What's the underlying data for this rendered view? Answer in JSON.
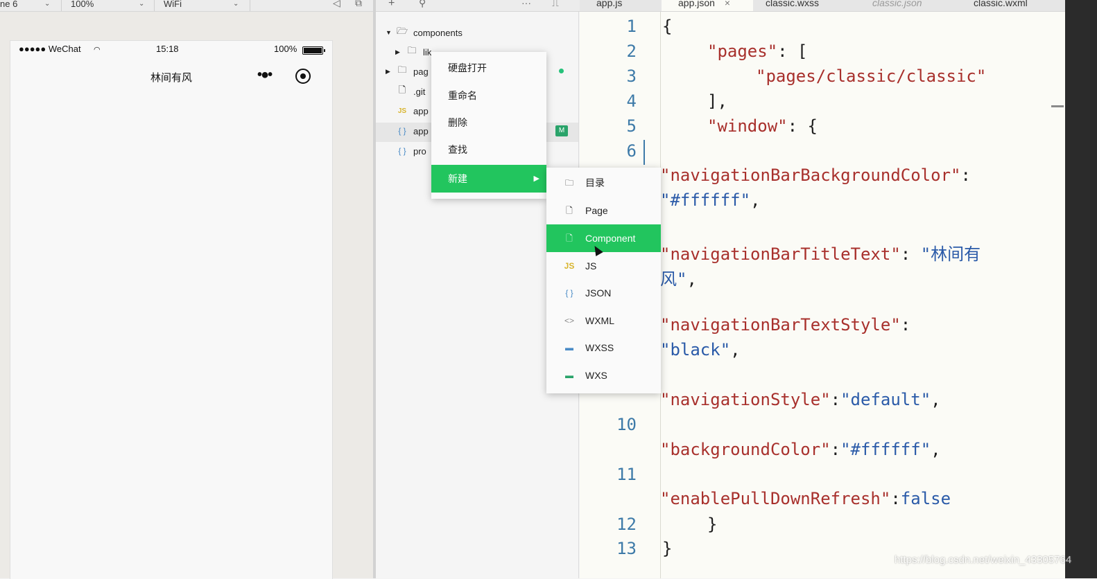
{
  "toolbar": {
    "device": "ne 6",
    "zoom": "100%",
    "network": "WiFi",
    "add_icon": "+",
    "search_icon": "⚲",
    "more_icon": "···"
  },
  "tabs": [
    {
      "label": "app.js"
    },
    {
      "label": "app.json",
      "close": "×"
    },
    {
      "label": "classic.wxss"
    },
    {
      "label": "classic.json"
    },
    {
      "label": "classic.wxml"
    }
  ],
  "phone": {
    "carrier": "●●●●● WeChat",
    "time": "15:18",
    "battery_text": "100%",
    "nav_title": "林间有风",
    "capsule_dots": "•●•"
  },
  "explorer": {
    "items": [
      {
        "label": "components"
      },
      {
        "label": "lik"
      },
      {
        "label": "pag"
      },
      {
        "label": ".git"
      },
      {
        "label": "app"
      },
      {
        "label": "app"
      },
      {
        "label": "pro"
      }
    ],
    "modified_badge": "M"
  },
  "context_menu": {
    "items": [
      "硬盘打开",
      "重命名",
      "删除",
      "查找",
      "新建"
    ],
    "submenu_arrow": "▶"
  },
  "submenu": {
    "items": [
      {
        "label": "目录",
        "icon": "folder-icon"
      },
      {
        "label": "Page",
        "icon": "file-icon"
      },
      {
        "label": "Component",
        "icon": "file-icon"
      },
      {
        "label": "JS",
        "icon": "js-icon"
      },
      {
        "label": "JSON",
        "icon": "json-icon"
      },
      {
        "label": "WXML",
        "icon": "wxml-icon"
      },
      {
        "label": "WXSS",
        "icon": "wxss-icon"
      },
      {
        "label": "WXS",
        "icon": "wxs-icon"
      }
    ]
  },
  "editor": {
    "line_numbers": [
      "1",
      "2",
      "3",
      "4",
      "5",
      "6",
      "10",
      "11",
      "12",
      "13"
    ],
    "lines": {
      "l1": "{",
      "l2_key": "\"pages\"",
      "l2_rest": ": [",
      "l3": "\"pages/classic/classic\"",
      "l4": "],",
      "l5_key": "\"window\"",
      "l5_rest": ": {",
      "l7_key": "\"navigationBarBackgroundColor\"",
      "l7_rest": ":",
      "l8_val": "\"#ffffff\"",
      "l8_rest": ",",
      "l9_key": "\"navigationBarTitleText\"",
      "l9_sep": ": ",
      "l9_val": "\"林间有",
      "l10_val": "风\"",
      "l10_rest": ",",
      "l11_key": "\"navigationBarTextStyle\"",
      "l11_rest": ":",
      "l12_val": "\"black\"",
      "l12_rest": ",",
      "l13_key": "\"navigationStyle\"",
      "l13_sep": ":",
      "l13_val": "\"default\"",
      "l13_rest": ",",
      "l14_key": "\"backgroundColor\"",
      "l14_sep": ":",
      "l14_val": "\"#ffffff\"",
      "l14_rest": ",",
      "l15_key": "\"enablePullDownRefresh\"",
      "l15_sep": ":",
      "l15_val": "false",
      "l16": "}",
      "l17": "}"
    }
  },
  "watermark": "https://blog.csdn.net/weixin_43305764",
  "colors": {
    "accent_green": "#22c55e",
    "json_key": "#a8302c",
    "json_string": "#2a5aa8",
    "line_number": "#3d7aa8"
  }
}
